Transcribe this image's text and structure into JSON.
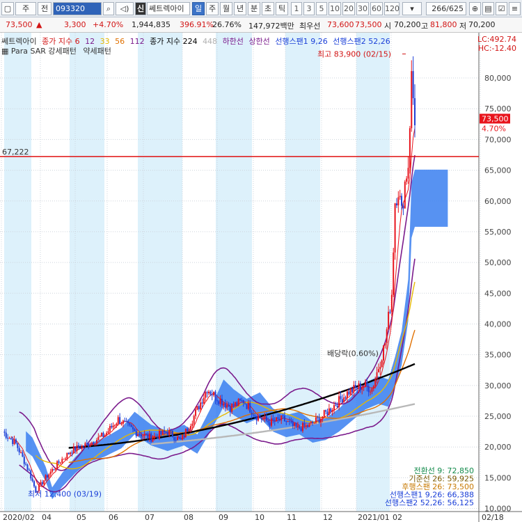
{
  "toolbar": {
    "window_icon": "▢",
    "type_select": "주",
    "period_select": "전",
    "code": "093320",
    "search_icon": "search-icon",
    "badge": "신",
    "stock_name": "쎄트렉아이",
    "periods": [
      "일",
      "주",
      "월",
      "년",
      "분",
      "초",
      "틱"
    ],
    "active_period": "일",
    "intervals": [
      "1",
      "3",
      "5",
      "10",
      "20",
      "30",
      "60",
      "120"
    ],
    "counter": "266/625"
  },
  "quote": {
    "price": "73,500",
    "change_symbol": "▲",
    "change": "3,300",
    "change_pct": "+4.70%",
    "volume": "1,944,835",
    "vol_ratio": "396.91%",
    "turnover_rate": "26.76%",
    "amount": "147,972백만",
    "ask_label": "최우선",
    "best_ask": "73,600",
    "best_bid": "73,500",
    "open_label": "시",
    "open": "70,200",
    "high_label": "고",
    "high": "81,800",
    "low_label": "저",
    "low": "70,200"
  },
  "legend": {
    "name": "쎄트렉아이",
    "close_index": "종가 지수 6",
    "ma12": "12",
    "ma33": "33",
    "ma56": "56",
    "ma112": "112",
    "close_index2": "종가 지수 224",
    "ma448": "448",
    "lower_band": "하한선",
    "upper_band": "상한선",
    "span1": "선행스팬1 9,26",
    "span2": "선행스팬2 52,26",
    "para": "Para SAR 강세패턴",
    "weak": "약세패턴",
    "lc": "LC:492.74",
    "hc": "HC:-12.40"
  },
  "chart_data": {
    "type": "candlestick",
    "x_labels": [
      "2020/02",
      "04",
      "05",
      "06",
      "07",
      "08",
      "09",
      "10",
      "11",
      "12",
      "2021/01",
      "02",
      "02/18"
    ],
    "y_ticks": [
      "10,000",
      "15,000",
      "20,000",
      "25,000",
      "30,000",
      "35,000",
      "40,000",
      "45,000",
      "50,000",
      "55,000",
      "60,000",
      "65,000",
      "70,000",
      "75,000",
      "80,000"
    ],
    "ylim": [
      9500,
      86000
    ],
    "price_line": {
      "value": 67222,
      "label": "67,222"
    },
    "current": {
      "value": "73,500",
      "pct": "4.70%"
    },
    "max_label": "최고 83,900 (02/15)",
    "min_label": "최저 12,400 (03/19)",
    "dividend_label": "배당락(0.60%)",
    "ichimoku_values": [
      {
        "text": "전환선 9: 72,850",
        "color": "#128a4a"
      },
      {
        "text": "기준선 26: 59,925",
        "color": "#7a5a00"
      },
      {
        "text": "후행스팬 26: 73,500",
        "color": "#c77800"
      },
      {
        "text": "선행스팬1 9,26: 66,388",
        "color": "#1a3fd8"
      },
      {
        "text": "선행스팬2 52,26: 56,125",
        "color": "#1a3fd8"
      }
    ],
    "colors": {
      "up": "#e8141c",
      "down": "#1f3fd6",
      "cloud": "#3a7ff0",
      "ma224": "#000000",
      "ma448": "#b8b8b8",
      "band": "#7b1b8c",
      "hline": "#e01010"
    }
  }
}
